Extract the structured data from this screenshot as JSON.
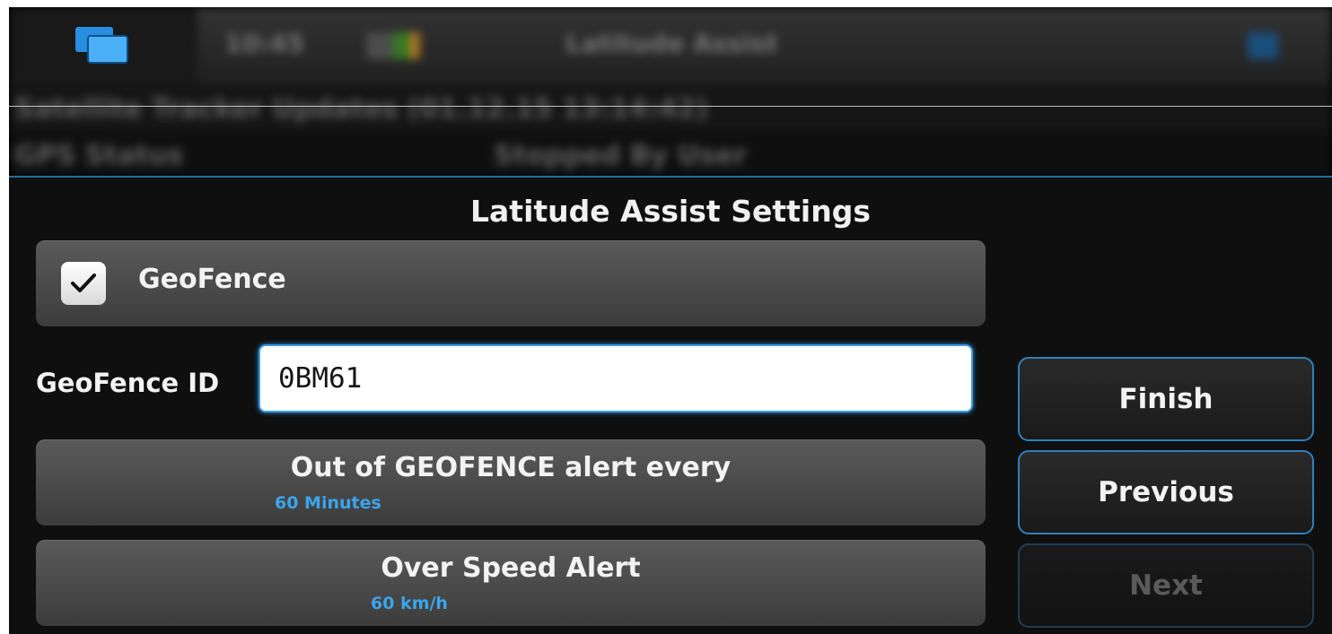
{
  "background": {
    "topbar_time": "",
    "topbar_app": "Latitude Assist",
    "row1": "Satellite Tracker Updates (01.12.15 13:14:42)",
    "row2_label": "GPS Status",
    "row2_value": "Stopped By User"
  },
  "dialog": {
    "title": "Latitude Assist Settings",
    "geofence_checkbox": {
      "label": "GeoFence",
      "checked": true
    },
    "geofence_id": {
      "label": "GeoFence ID",
      "value": "0BM61"
    },
    "out_of_geofence": {
      "title": "Out of GEOFENCE alert every",
      "value": "60 Minutes"
    },
    "over_speed": {
      "title": "Over Speed Alert",
      "value": "60 km/h"
    },
    "buttons": {
      "finish": "Finish",
      "previous": "Previous",
      "next": "Next"
    }
  },
  "colors": {
    "accent": "#3ba5ea",
    "dialog_border": "#1d6fa3",
    "panel_top": "#5a5a5a",
    "panel_bottom": "#3c3c3c"
  },
  "icons": {
    "home": "app-switcher-icon",
    "checkmark": "checkmark-icon",
    "menu": "menu-icon"
  }
}
